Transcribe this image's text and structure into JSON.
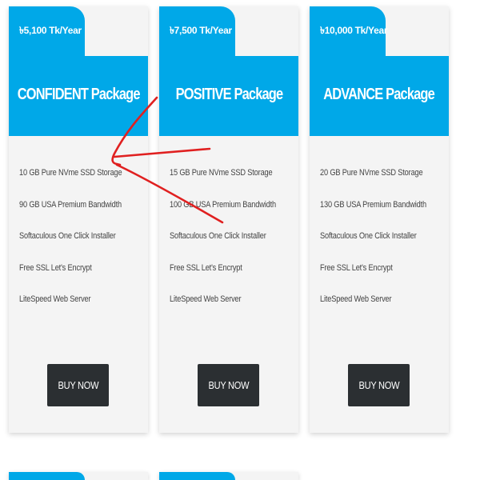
{
  "colors": {
    "accent": "#00a8e8",
    "card_bg": "#f4f4f4",
    "button_bg": "#2b2f32",
    "annotation": "#e02020"
  },
  "packages": [
    {
      "price": "৳5,100 Tk/Year",
      "name": "CONFIDENT Package",
      "features": [
        "10 GB Pure NVme SSD Storage",
        "90 GB USA Premium Bandwidth",
        "Softaculous One Click Installer",
        "Free SSL Let's Encrypt",
        "LiteSpeed Web Server"
      ],
      "button": "BUY NOW"
    },
    {
      "price": "৳7,500 Tk/Year",
      "name": "POSITIVE Package",
      "features": [
        "15 GB Pure NVme SSD Storage",
        "100 GB USA Premium Bandwidth",
        "Softaculous One Click Installer",
        "Free SSL Let's Encrypt",
        "LiteSpeed Web Server"
      ],
      "button": "BUY NOW"
    },
    {
      "price": "৳10,000 Tk/Year",
      "name": "ADVANCE Package",
      "features": [
        "20 GB Pure NVme SSD Storage",
        "130 GB USA Premium Bandwidth",
        "Softaculous One Click Installer",
        "Free SSL Let's Encrypt",
        "LiteSpeed Web Server"
      ],
      "button": "BUY NOW"
    }
  ]
}
